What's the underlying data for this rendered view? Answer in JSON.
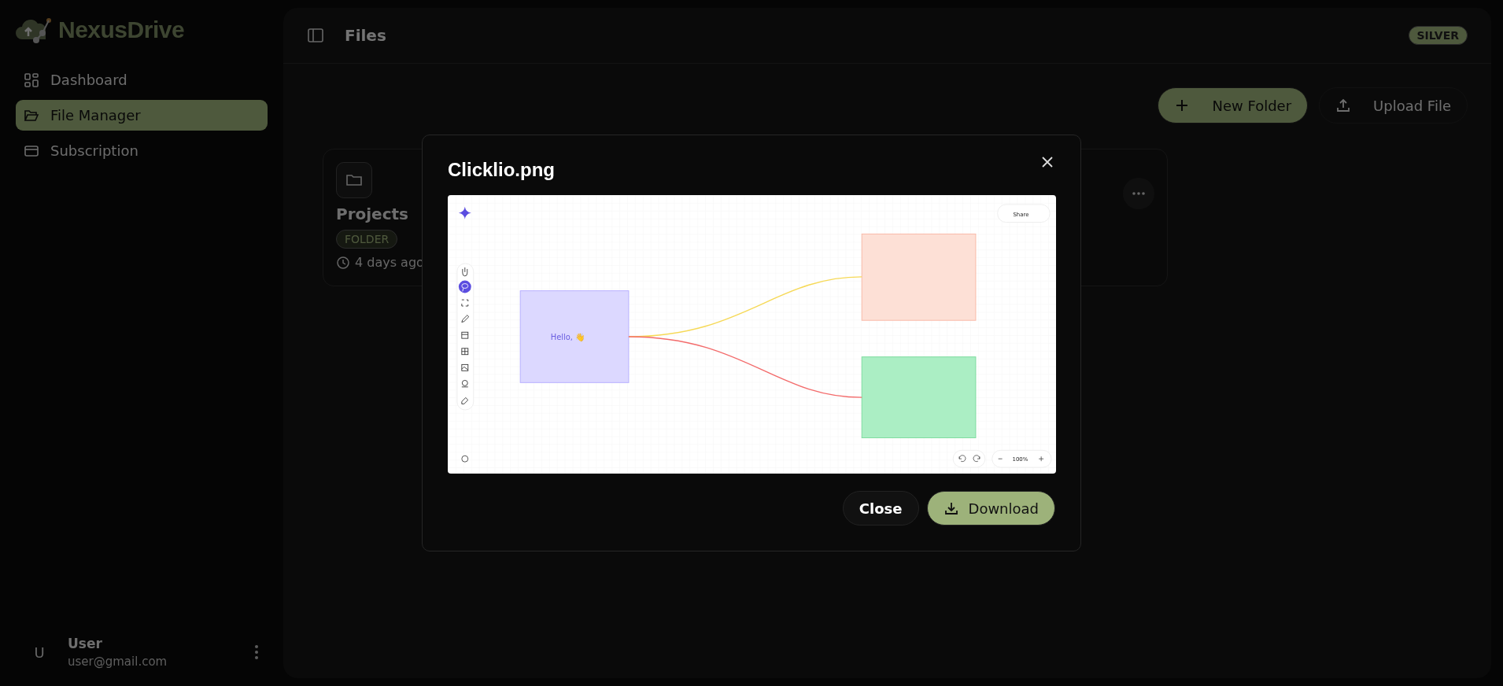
{
  "sidebar": {
    "brand": "NexusDrive",
    "items": [
      {
        "label": "Dashboard",
        "kind": "dashboard",
        "selected": false
      },
      {
        "label": "File Manager",
        "kind": "files",
        "selected": true
      },
      {
        "label": "Subscription",
        "kind": "subscription",
        "selected": false
      }
    ],
    "user": {
      "avatar": "U",
      "name": "User",
      "email": "user@gmail.com"
    }
  },
  "header": {
    "title": "Files",
    "plan_badge": "SILVER"
  },
  "actions": [
    {
      "label": "New Folder",
      "kind": "new"
    },
    {
      "label": "Upload File",
      "kind": "upload"
    }
  ],
  "folders": [
    {
      "name": "Projects",
      "tag": "FOLDER",
      "modified": "4 days ago"
    }
  ],
  "modal": {
    "title": "Clicklio.png",
    "preview": {
      "share": "Share",
      "note": "Hello, 👋",
      "zoom": "100%",
      "tools": [
        {
          "kind": "hand",
          "selected": false
        },
        {
          "kind": "lasso",
          "selected": true
        },
        {
          "kind": "select",
          "selected": false
        },
        {
          "kind": "pen",
          "selected": false
        },
        {
          "kind": "frame",
          "selected": false
        },
        {
          "kind": "table",
          "selected": false
        },
        {
          "kind": "image",
          "selected": false
        },
        {
          "kind": "webcam",
          "selected": false
        },
        {
          "kind": "eraser",
          "selected": false
        }
      ]
    },
    "buttons": [
      {
        "label": "Close",
        "kind": "secondary"
      },
      {
        "label": "Download",
        "kind": "primary"
      }
    ]
  }
}
